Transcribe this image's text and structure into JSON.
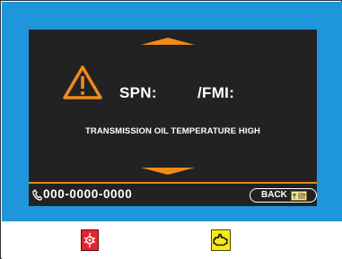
{
  "screen": {
    "spn_label": "SPN:",
    "fmi_label": "/FMI:",
    "message": "TRANSMISSION OIL TEMPERATURE HIGH",
    "phone_number": "000-0000-0000",
    "back_label": "BACK"
  },
  "icons": {
    "warning": "warning-triangle-icon",
    "scroll_up": "arrow-up-icon",
    "scroll_down": "arrow-down-icon",
    "phone": "phone-icon",
    "back": "back-icon",
    "stop_lamp": "stop-lamp-icon",
    "check_engine": "check-engine-icon"
  },
  "colors": {
    "accent": "#f28a1b",
    "screen_bg": "#222222",
    "bezel_blue": "#1f95dc",
    "stop_lamp": "#e3262b",
    "check_engine_lamp": "#f3ea18"
  }
}
